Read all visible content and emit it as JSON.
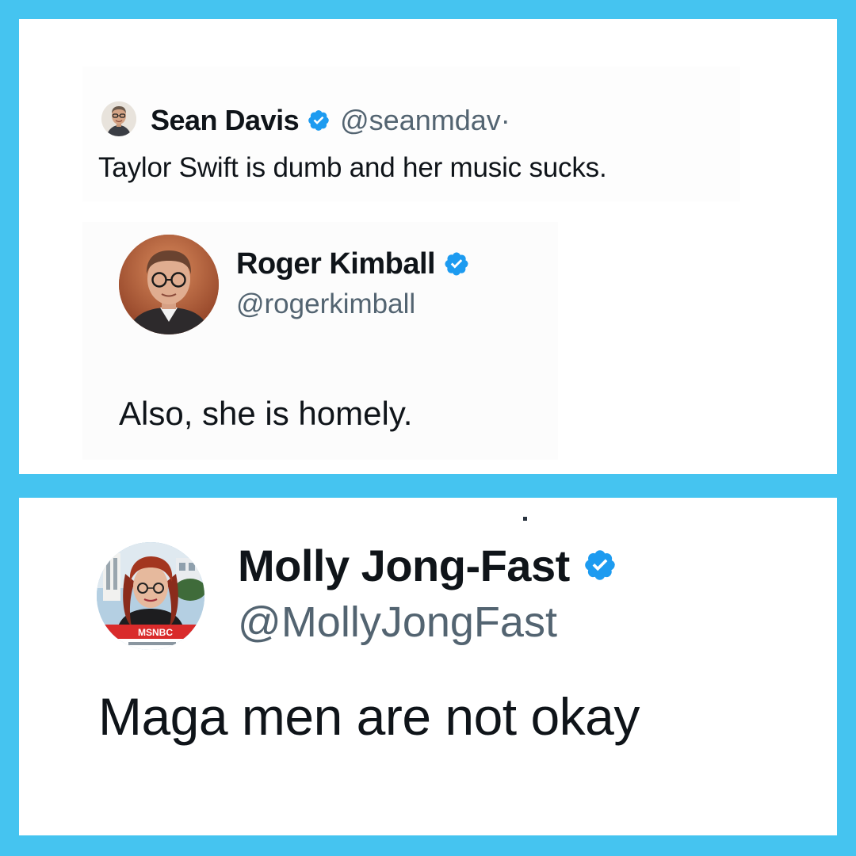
{
  "colors": {
    "frame": "#45c4f0",
    "verified": "#1d9bf0",
    "text_primary": "#0f1419",
    "text_secondary": "#536471"
  },
  "tweets": [
    {
      "display_name": "Sean Davis",
      "verified": true,
      "handle": "@seanmdav",
      "separator": "·",
      "text": "Taylor Swift is dumb and her music sucks.",
      "avatar_icon": "profile-photo-icon"
    },
    {
      "display_name": "Roger Kimball",
      "verified": true,
      "handle": "@rogerkimball",
      "text": "Also, she is homely.",
      "avatar_icon": "profile-photo-icon"
    },
    {
      "display_name": "Molly Jong-Fast",
      "verified": true,
      "handle": "@MollyJongFast",
      "text": "Maga men are not okay",
      "avatar_icon": "profile-photo-icon",
      "avatar_badge": "MSNBC"
    }
  ]
}
